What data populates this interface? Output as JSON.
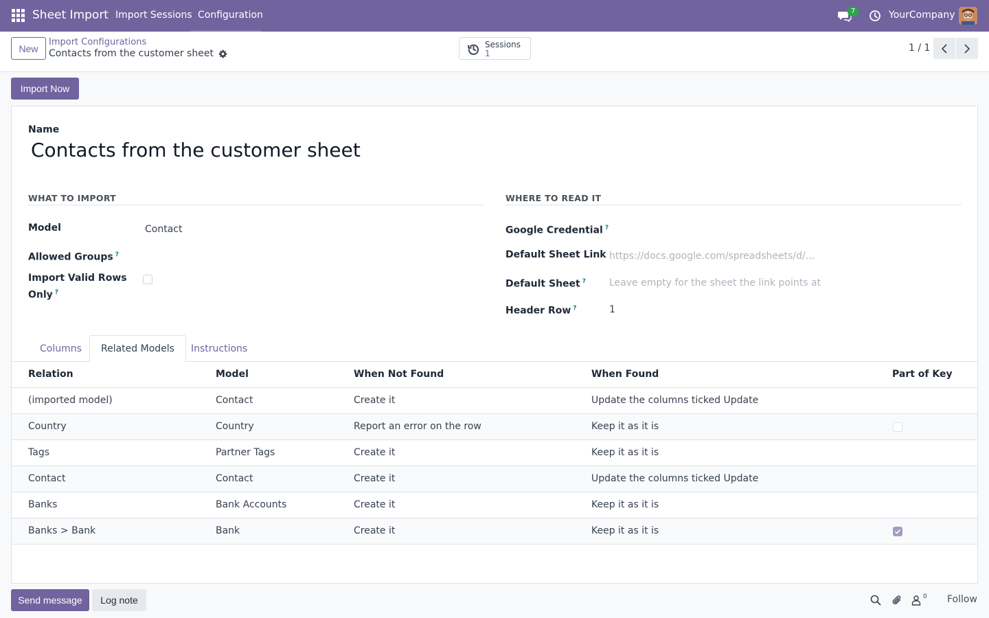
{
  "navbar": {
    "app_name": "Sheet Import",
    "menu": [
      "Import Sessions",
      "Configuration"
    ],
    "message_count": "7",
    "company": "YourCompany"
  },
  "control": {
    "new_label": "New",
    "breadcrumb_parent": "Import Configurations",
    "breadcrumb_current": "Contacts from the customer sheet",
    "sessions_label": "Sessions",
    "sessions_count": "1",
    "pager": "1 / 1"
  },
  "actions": {
    "import_now": "Import Now"
  },
  "form": {
    "name_label": "Name",
    "name_value": "Contacts from the customer sheet",
    "left_section": "WHAT TO IMPORT",
    "right_section": "WHERE TO READ IT",
    "model_label": "Model",
    "model_value": "Contact",
    "allowed_groups_label": "Allowed Groups",
    "import_valid_label_line1": "Import Valid Rows",
    "import_valid_label_line2": "Only",
    "google_credential_label": "Google Credential",
    "default_sheet_link_label": "Default Sheet Link",
    "default_sheet_link_placeholder": "https://docs.google.com/spreadsheets/d/...",
    "default_sheet_label": "Default Sheet",
    "default_sheet_placeholder": "Leave empty for the sheet the link points at",
    "header_row_label": "Header Row",
    "header_row_value": "1",
    "help_mark": "?"
  },
  "tabs": [
    "Columns",
    "Related Models",
    "Instructions"
  ],
  "table": {
    "headers": [
      "Relation",
      "Model",
      "When Not Found",
      "When Found",
      "Part of Key"
    ],
    "rows": [
      {
        "relation": "(imported model)",
        "model": "Contact",
        "not_found": "Create it",
        "found": "Update the columns ticked Update",
        "part_of_key": null
      },
      {
        "relation": "Country",
        "model": "Country",
        "not_found": "Report an error on the row",
        "found": "Keep it as it is",
        "part_of_key": false
      },
      {
        "relation": "Tags",
        "model": "Partner Tags",
        "not_found": "Create it",
        "found": "Keep it as it is",
        "part_of_key": null
      },
      {
        "relation": "Contact",
        "model": "Contact",
        "not_found": "Create it",
        "found": "Update the columns ticked Update",
        "part_of_key": null
      },
      {
        "relation": "Banks",
        "model": "Bank Accounts",
        "not_found": "Create it",
        "found": "Keep it as it is",
        "part_of_key": null
      },
      {
        "relation": "Banks > Bank",
        "model": "Bank",
        "not_found": "Create it",
        "found": "Keep it as it is",
        "part_of_key": true
      }
    ]
  },
  "chatter": {
    "send_message": "Send message",
    "log_note": "Log note",
    "follower_count": "0",
    "follow": "Follow"
  },
  "colors": {
    "brand": "#71639e",
    "badge": "#28a745",
    "help": "#017e84"
  }
}
